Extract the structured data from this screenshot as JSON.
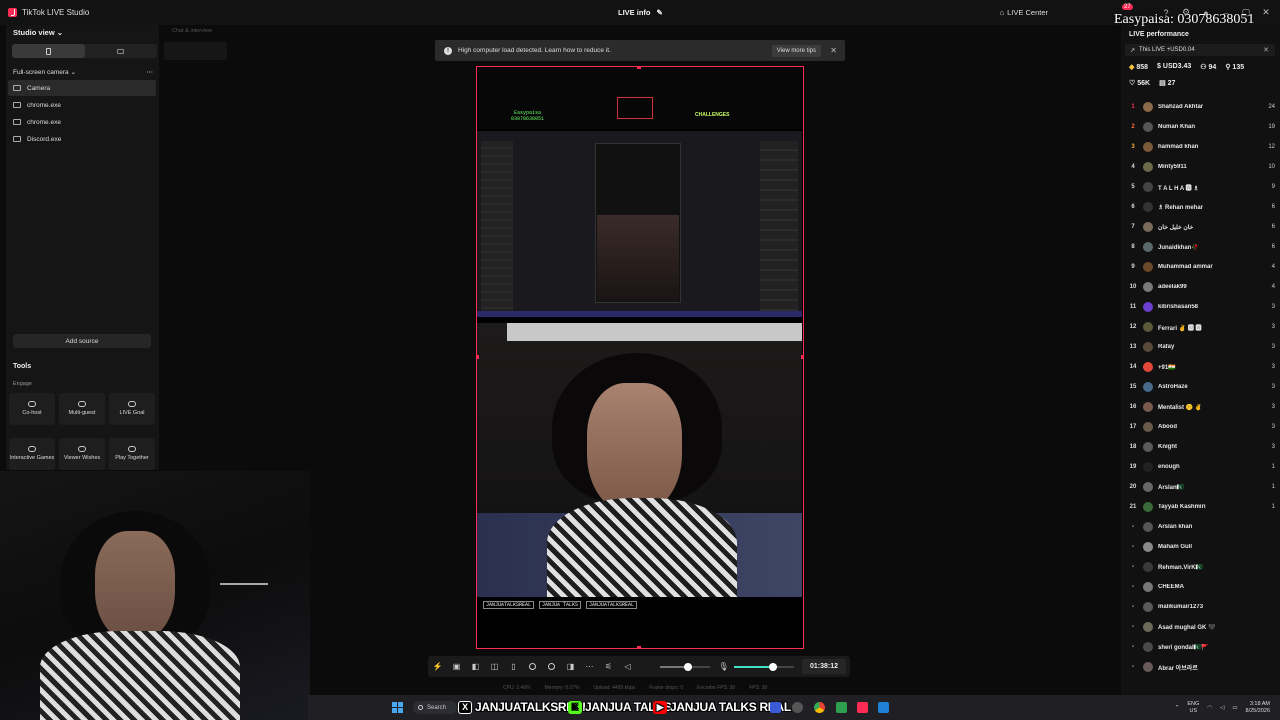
{
  "titlebar": {
    "app_name": "TikTok LIVE Studio",
    "center_label": "LIVE info",
    "live_center": "LIVE Center",
    "notif_count": "27"
  },
  "overlay_text": "Easypaisa: 03078638051",
  "left_panel": {
    "studio_view": "Studio view",
    "scene_name": "Full-screen camera",
    "sources": [
      "Camera",
      "chrome.exe",
      "chrome.exe",
      "Discord.exe"
    ],
    "add_source": "Add source",
    "tools_title": "Tools",
    "engage_label": "Engage",
    "tools": [
      {
        "label": "Co-host"
      },
      {
        "label": "Multi-guest"
      },
      {
        "label": "LIVE Goal"
      },
      {
        "label": "Interactive Games"
      },
      {
        "label": "Viewer Wishes"
      },
      {
        "label": "Play Together"
      }
    ]
  },
  "chat": {
    "tab_label": "Chat & interview"
  },
  "warning": {
    "message": "High computer load detected. Learn how to reduce it.",
    "tips_button": "View more tips"
  },
  "preview": {
    "mini_text": "Easypaisa\n03078638051",
    "mini_text2": "CHALLENGES",
    "ticker": [
      "JANJUATALKSREAL",
      "JANJUA TALKS",
      "JANJUATALKSREAL"
    ]
  },
  "controls": {
    "timer": "01:38:12",
    "volume_level": 0.55,
    "mic_level": 0.65
  },
  "stats": {
    "cpu": "CPU: 2.49%",
    "memory": "Memory: 0.07%",
    "upload": "Upload: 4489 kbps",
    "frame_drops": "Frame drops: 0",
    "encoder_fps": "Encoder FPS: 30",
    "fps": "FPS: 30"
  },
  "right_panel": {
    "title": "LIVE performance",
    "this_live": "This LIVE +USD0.04",
    "stat_diamonds": "858",
    "stat_usd": "USD3.43",
    "stat_viewers": "94",
    "stat_followers": "135",
    "stat_likes": "56K",
    "stat_gifters": "27",
    "viewers": [
      {
        "rank": "1",
        "name": "Shahzad Akhtar",
        "score": "24",
        "color": "#8a6a4a"
      },
      {
        "rank": "2",
        "name": "Numan Khan",
        "score": "19",
        "color": "#555555"
      },
      {
        "rank": "3",
        "name": "hammad khan",
        "score": "12",
        "color": "#7a5a3a"
      },
      {
        "rank": "4",
        "name": "Minty5911",
        "score": "10",
        "color": "#6a6a4a"
      },
      {
        "rank": "5",
        "name": "T A L H A 🆆 ♗",
        "score": "9",
        "color": "#444444"
      },
      {
        "rank": "6",
        "name": "♗ Rehan mehar",
        "score": "6",
        "color": "#333333"
      },
      {
        "rank": "7",
        "name": "خان خلیل خان",
        "score": "6",
        "color": "#7a6a5a"
      },
      {
        "rank": "8",
        "name": "Junaidkhan🥀",
        "score": "6",
        "color": "#5a6a6a"
      },
      {
        "rank": "9",
        "name": "Muhammad ammar",
        "score": "4",
        "color": "#6a4a2a"
      },
      {
        "rank": "10",
        "name": "adeelak99",
        "score": "4",
        "color": "#7a7a7a"
      },
      {
        "rank": "11",
        "name": "kibrishasan58",
        "score": "3",
        "color": "#6a3fd0"
      },
      {
        "rank": "12",
        "name": "Ferrari ✌️ 🆆 🆆",
        "score": "3",
        "color": "#5a5a3a"
      },
      {
        "rank": "13",
        "name": "Rafay",
        "score": "3",
        "color": "#5a4a3a"
      },
      {
        "rank": "14",
        "name": "+91🇮🇳",
        "score": "3",
        "color": "#e2483a"
      },
      {
        "rank": "15",
        "name": "AstroHaze",
        "score": "3",
        "color": "#4a6a8a"
      },
      {
        "rank": "16",
        "name": "Mentalist 🤫 ✌️",
        "score": "3",
        "color": "#7a5a4a"
      },
      {
        "rank": "17",
        "name": "Abood",
        "score": "3",
        "color": "#6a5a4a"
      },
      {
        "rank": "18",
        "name": "Knight",
        "score": "3",
        "color": "#5a5a5a"
      },
      {
        "rank": "19",
        "name": "enough",
        "score": "1",
        "color": "#222222"
      },
      {
        "rank": "20",
        "name": "Arslan🇵🇰",
        "score": "1",
        "color": "#666666"
      },
      {
        "rank": "21",
        "name": "Tayyab Kashmiri",
        "score": "1",
        "color": "#3a6a3a"
      },
      {
        "rank": "-",
        "name": "Arslan khan",
        "score": "",
        "color": "#555555"
      },
      {
        "rank": "-",
        "name": "Maham Gull",
        "score": "",
        "color": "#8a8a8a"
      },
      {
        "rank": "-",
        "name": "Rehman.VirK🇵🇰",
        "score": "",
        "color": "#3a3a3a"
      },
      {
        "rank": "-",
        "name": "CHEEMA",
        "score": "",
        "color": "#777777"
      },
      {
        "rank": "-",
        "name": "malikumair1273",
        "score": "",
        "color": "#5a5a5a"
      },
      {
        "rank": "-",
        "name": "Asad mughal GK 🖤",
        "score": "",
        "color": "#6a6a5a"
      },
      {
        "rank": "-",
        "name": "sheri gondal🇵🇰🚩",
        "score": "",
        "color": "#4a4a4a"
      },
      {
        "rank": "-",
        "name": "Abrar 아브라르",
        "score": "",
        "color": "#6a5a5a"
      }
    ]
  },
  "taskbar": {
    "search": "Search",
    "banner1": "JANJUATALKSREAL",
    "banner2": "JANJUA TALKS",
    "banner3": "JANJUA TALKS REAL",
    "lang_top": "ENG",
    "lang_bottom": "US",
    "time": "3:18 AM",
    "date": "8/25/2026"
  }
}
